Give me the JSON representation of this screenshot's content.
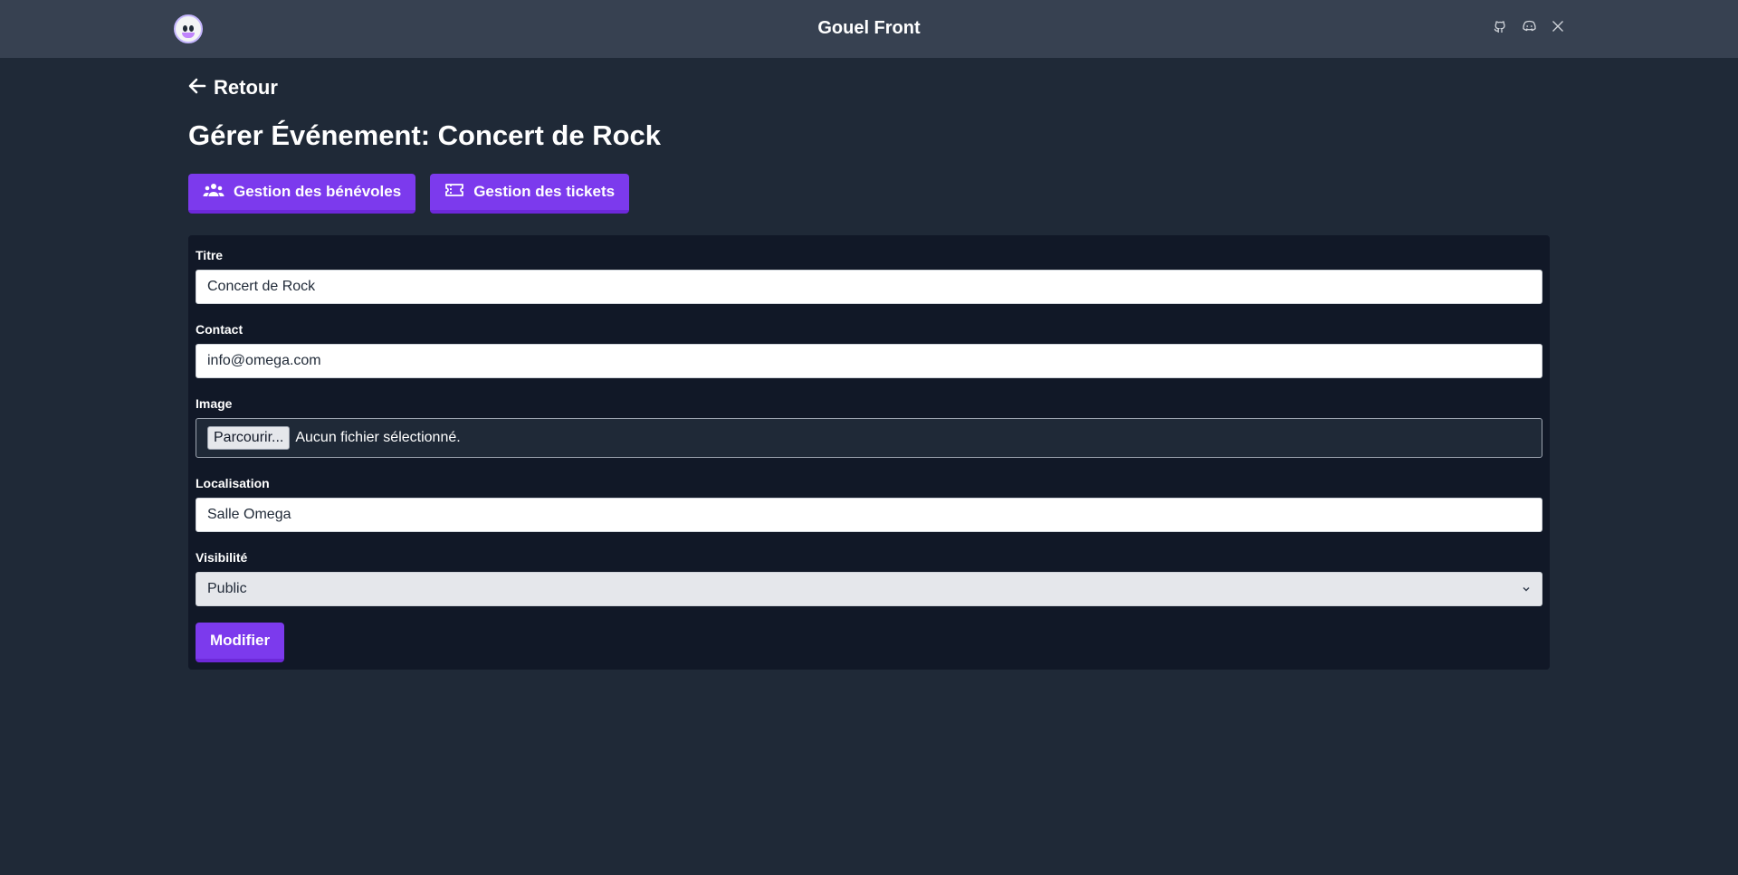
{
  "header": {
    "title": "Gouel Front",
    "social": [
      {
        "icon": "github-icon"
      },
      {
        "icon": "discord-icon"
      },
      {
        "icon": "x-twitter-icon"
      }
    ]
  },
  "nav": {
    "back_label": "Retour"
  },
  "page": {
    "title": "Gérer Événement: Concert de Rock"
  },
  "actions": {
    "volunteers_label": "Gestion des bénévoles",
    "tickets_label": "Gestion des tickets"
  },
  "form": {
    "title": {
      "label": "Titre",
      "value": "Concert de Rock"
    },
    "contact": {
      "label": "Contact",
      "value": "info@omega.com"
    },
    "image": {
      "label": "Image",
      "button_label": "Parcourir...",
      "status": "Aucun fichier sélectionné."
    },
    "location": {
      "label": "Localisation",
      "value": "Salle Omega"
    },
    "visibility": {
      "label": "Visibilité",
      "selected": "Public"
    },
    "submit_label": "Modifier"
  },
  "colors": {
    "accent": "#7c3aed",
    "background": "#1f2937",
    "header": "#374151",
    "card": "#111827"
  }
}
